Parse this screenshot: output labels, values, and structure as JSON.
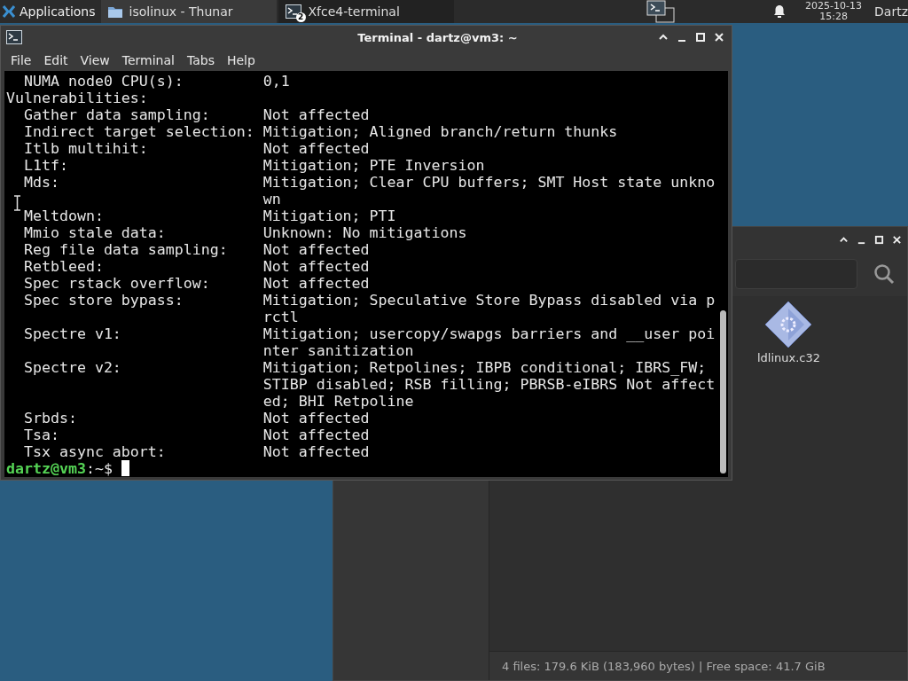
{
  "panel": {
    "menu_label": "Applications",
    "tasks": [
      {
        "label": "isolinux - Thunar",
        "selected": false,
        "kind": "folder"
      },
      {
        "label": "Xfce4-terminal",
        "selected": true,
        "kind": "terminal",
        "badge": "2"
      }
    ],
    "clock": {
      "date": "2025-10-13",
      "time": "15:28"
    },
    "user": "Dartz"
  },
  "terminal": {
    "title": "Terminal - dartz@vm3: ~",
    "menu": [
      "File",
      "Edit",
      "View",
      "Terminal",
      "Tabs",
      "Help"
    ],
    "lines": [
      {
        "kind": "item",
        "label": "NUMA node0 CPU(s):",
        "value": "0,1"
      },
      {
        "kind": "heading",
        "label": "Vulnerabilities:"
      },
      {
        "kind": "item",
        "label": "Gather data sampling:",
        "value": "Not affected"
      },
      {
        "kind": "item",
        "label": "Indirect target selection:",
        "value": "Mitigation; Aligned branch/return thunks"
      },
      {
        "kind": "item",
        "label": "Itlb multihit:",
        "value": "Not affected"
      },
      {
        "kind": "item",
        "label": "L1tf:",
        "value": "Mitigation; PTE Inversion"
      },
      {
        "kind": "item",
        "label": "Mds:",
        "value": "Mitigation; Clear CPU buffers; SMT Host state unkno"
      },
      {
        "kind": "continuation",
        "value": "wn"
      },
      {
        "kind": "item",
        "label": "Meltdown:",
        "value": "Mitigation; PTI"
      },
      {
        "kind": "item",
        "label": "Mmio stale data:",
        "value": "Unknown: No mitigations"
      },
      {
        "kind": "item",
        "label": "Reg file data sampling:",
        "value": "Not affected"
      },
      {
        "kind": "item",
        "label": "Retbleed:",
        "value": "Not affected"
      },
      {
        "kind": "item",
        "label": "Spec rstack overflow:",
        "value": "Not affected"
      },
      {
        "kind": "item",
        "label": "Spec store bypass:",
        "value": "Mitigation; Speculative Store Bypass disabled via p"
      },
      {
        "kind": "continuation",
        "value": "rctl"
      },
      {
        "kind": "item",
        "label": "Spectre v1:",
        "value": "Mitigation; usercopy/swapgs barriers and __user poi"
      },
      {
        "kind": "continuation",
        "value": "nter sanitization"
      },
      {
        "kind": "item",
        "label": "Spectre v2:",
        "value": "Mitigation; Retpolines; IBPB conditional; IBRS_FW;"
      },
      {
        "kind": "continuation",
        "value": "STIBP disabled; RSB filling; PBRSB-eIBRS Not affect"
      },
      {
        "kind": "continuation",
        "value": "ed; BHI Retpoline"
      },
      {
        "kind": "item",
        "label": "Srbds:",
        "value": "Not affected"
      },
      {
        "kind": "item",
        "label": "Tsa:",
        "value": "Not affected"
      },
      {
        "kind": "item",
        "label": "Tsx async abort:",
        "value": "Not affected"
      }
    ],
    "prompt": {
      "user_host": "dartz@vm3",
      "separator": ":",
      "path": "~",
      "symbol": "$"
    }
  },
  "file_manager": {
    "files": [
      {
        "name": "ldlinux.c32"
      }
    ],
    "status": "4 files: 179.6 KiB (183,960 bytes) | Free space: 41.7 GiB"
  }
}
